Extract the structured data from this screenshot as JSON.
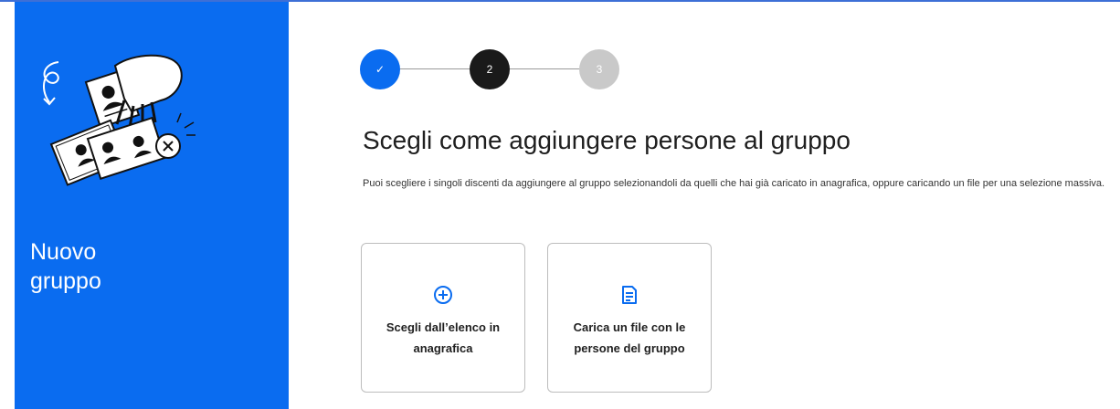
{
  "sidebar": {
    "title_line1": "Nuovo",
    "title_line2": "gruppo",
    "background_color": "#0a6cf0"
  },
  "stepper": {
    "steps": [
      {
        "label": "✓",
        "state": "done"
      },
      {
        "label": "2",
        "state": "current"
      },
      {
        "label": "3",
        "state": "todo"
      }
    ]
  },
  "main": {
    "title": "Scegli come aggiungere persone al gruppo",
    "description": "Puoi scegliere i singoli discenti da aggiungere al gruppo selezionandoli da quelli che hai già caricato in anagrafica, oppure caricando un file per una selezione massiva.",
    "options": [
      {
        "icon": "plus-circle-icon",
        "label_line1": "Scegli dall’elenco in",
        "label_line2": "anagrafica"
      },
      {
        "icon": "document-icon",
        "label_line1": "Carica un file con le",
        "label_line2": "persone del gruppo"
      }
    ]
  },
  "colors": {
    "accent": "#0a6cf0",
    "step_current": "#1a1a1a",
    "step_todo": "#c9c9c9"
  }
}
